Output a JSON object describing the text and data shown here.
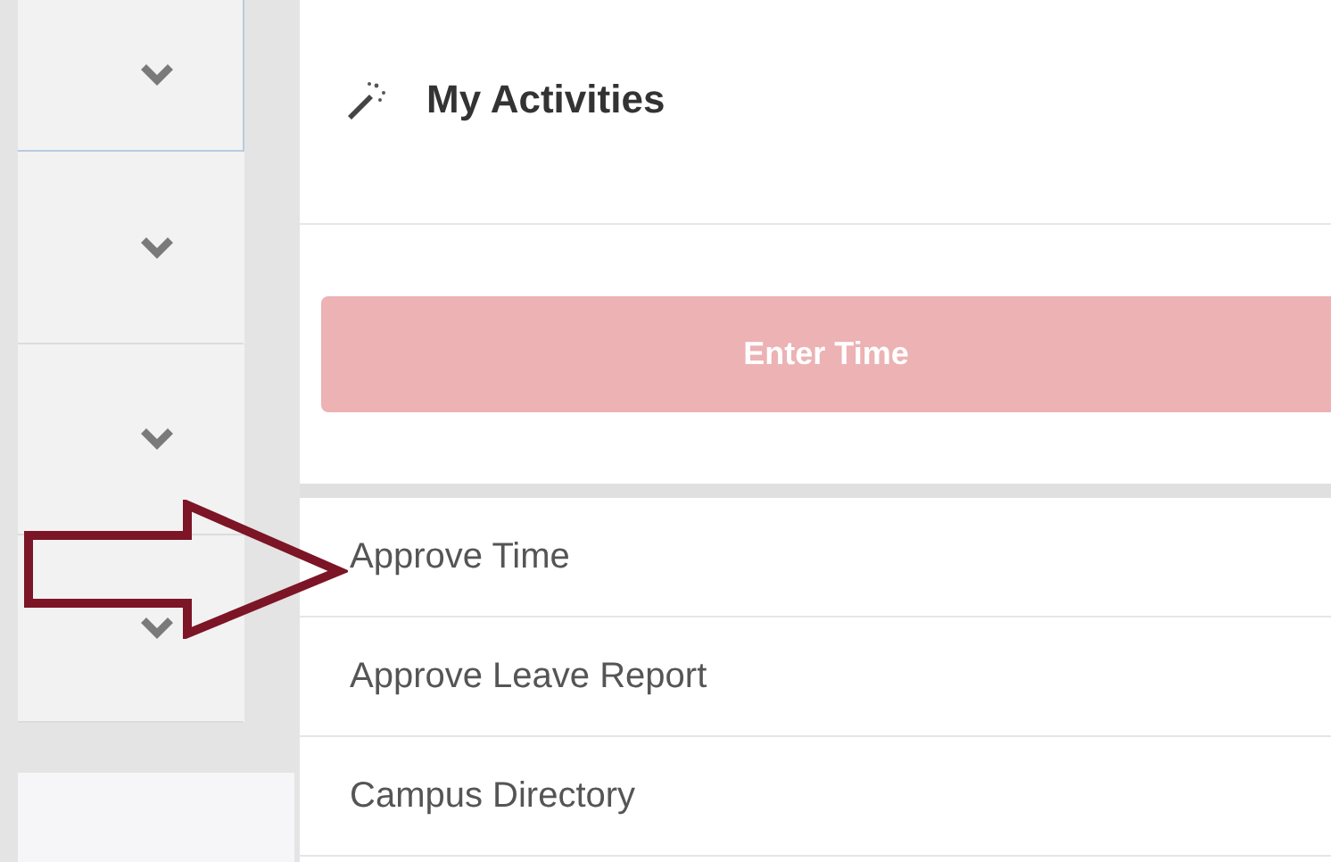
{
  "sidebar": {
    "panels": [
      {
        "kind": "chevron",
        "focused": true
      },
      {
        "kind": "chevron",
        "focused": false
      },
      {
        "kind": "chevron",
        "focused": false
      },
      {
        "kind": "chevron",
        "focused": false
      }
    ]
  },
  "activities": {
    "title": "My Activities",
    "primary_button": {
      "label": "Enter Time"
    },
    "items": [
      {
        "label": "Approve Time"
      },
      {
        "label": "Approve Leave Report"
      },
      {
        "label": "Campus Directory"
      }
    ]
  },
  "annotation": {
    "kind": "arrow"
  }
}
